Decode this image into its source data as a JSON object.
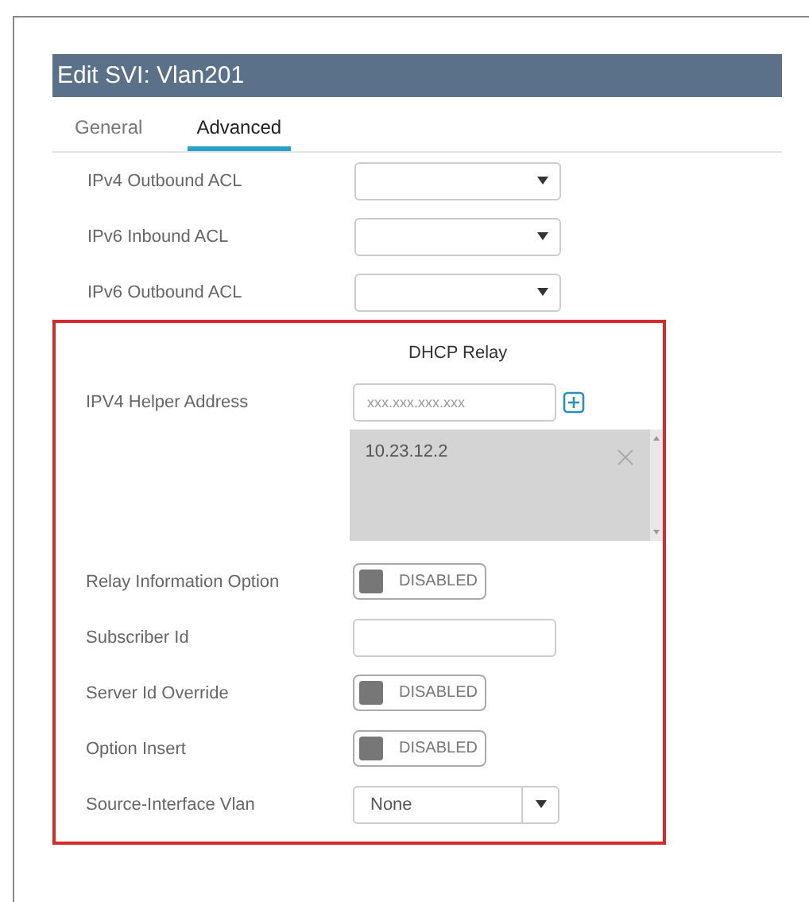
{
  "dialog": {
    "title": "Edit SVI: Vlan201"
  },
  "tabs": [
    {
      "label": "General",
      "selected": false
    },
    {
      "label": "Advanced",
      "selected": true
    }
  ],
  "acl_rows": [
    {
      "label": "IPv4 Outbound ACL"
    },
    {
      "label": "IPv6 Inbound ACL"
    },
    {
      "label": "IPv6 Outbound ACL"
    }
  ],
  "dhcp_relay": {
    "title": "DHCP Relay",
    "rows": [
      {
        "kind": "input",
        "label": "IPV4 Helper Address",
        "placeholder": "xxx.xxx.xxx.xxx",
        "add_button": true
      },
      {
        "kind": "list",
        "items": [
          "10.23.12.2"
        ]
      },
      {
        "kind": "toggle",
        "label": "Relay Information Option",
        "on": false,
        "state_text": "DISABLED"
      },
      {
        "kind": "input",
        "label": "Subscriber Id"
      },
      {
        "kind": "toggle",
        "label": "Server Id Override",
        "on": false,
        "state_text": "DISABLED"
      },
      {
        "kind": "toggle",
        "label": "Option Insert",
        "on": false,
        "state_text": "DISABLED"
      },
      {
        "kind": "select",
        "label": "Source-Interface Vlan",
        "value": "None"
      }
    ]
  }
}
